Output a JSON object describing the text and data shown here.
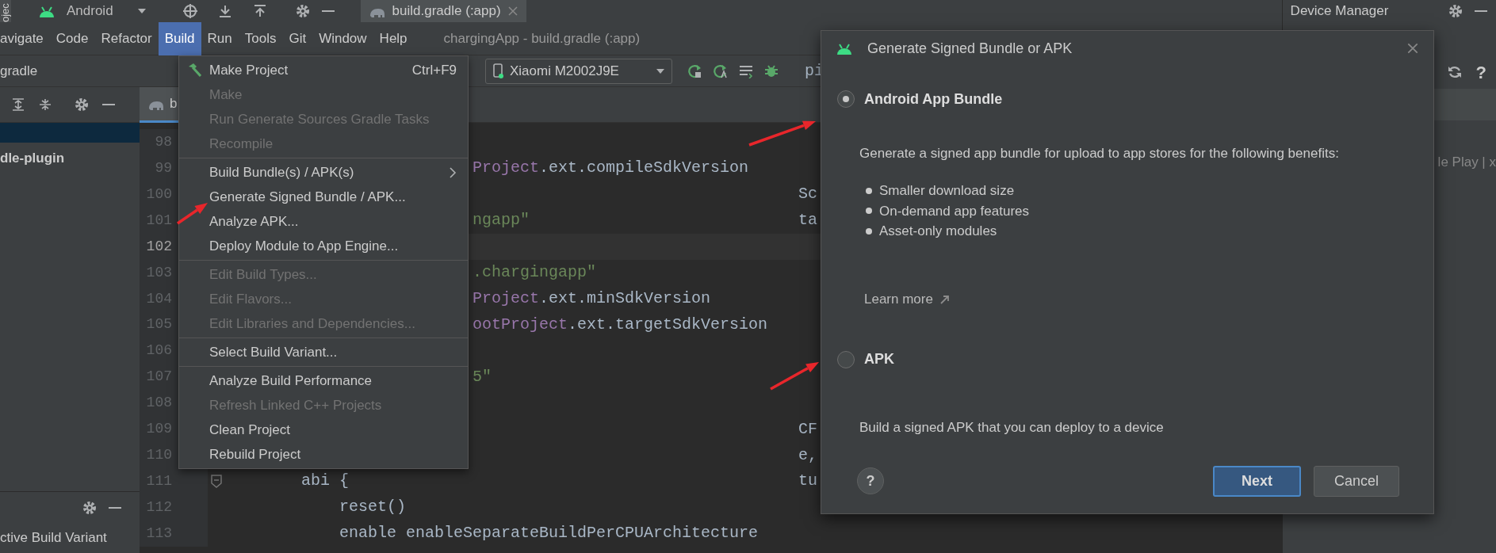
{
  "top_bar": {
    "side_tab": "ojec",
    "project_view": "Android",
    "editor_tab": "build.gradle (:app)"
  },
  "menu_bar": {
    "items": [
      {
        "label": "avigate",
        "selected": false
      },
      {
        "label": "Code",
        "selected": false
      },
      {
        "label": "Refactor",
        "selected": false
      },
      {
        "label": "Build",
        "selected": true
      },
      {
        "label": "Run",
        "selected": false
      },
      {
        "label": "Tools",
        "selected": false
      },
      {
        "label": "Git",
        "selected": false
      },
      {
        "label": "Window",
        "selected": false
      },
      {
        "label": "Help",
        "selected": false
      }
    ],
    "title": "chargingApp - build.gradle (:app)"
  },
  "toolbar": {
    "breadcrumb": "gradle",
    "device": "Xiaomi M2002J9E",
    "editor_fragment": "pi"
  },
  "editor_tabs": [
    {
      "label": "b",
      "selected": true
    }
  ],
  "project_panel": {
    "item": "dle-plugin"
  },
  "build_variants_panel": {
    "title": "ctive Build Variant"
  },
  "code_lines": [
    {
      "number": "98",
      "current": false,
      "kind": "behind_menu"
    },
    {
      "number": "99",
      "current": false,
      "kind": "behind_menu",
      "segments": [
        {
          "text": "Project",
          "kind": "field"
        },
        {
          "text": ".ext.compileSdkVersion",
          "kind": "plain"
        }
      ]
    },
    {
      "number": "100",
      "current": false,
      "kind": "behind_menu",
      "side": "Sc"
    },
    {
      "number": "101",
      "current": false,
      "kind": "behind_menu",
      "segments": [
        {
          "text": "ngapp\"",
          "kind": "string"
        }
      ],
      "side": "ta"
    },
    {
      "number": "102",
      "current": true,
      "kind": "behind_menu"
    },
    {
      "number": "103",
      "current": false,
      "kind": "behind_menu",
      "segments": [
        {
          "text": ".chargingapp\"",
          "kind": "string"
        }
      ]
    },
    {
      "number": "104",
      "current": false,
      "kind": "behind_menu",
      "segments": [
        {
          "text": "Project",
          "kind": "field"
        },
        {
          "text": ".ext.minSdkVersion",
          "kind": "plain"
        }
      ]
    },
    {
      "number": "105",
      "current": false,
      "kind": "behind_menu",
      "segments": [
        {
          "text": "ootProject",
          "kind": "field"
        },
        {
          "text": ".ext.targetSdkVersion",
          "kind": "plain"
        }
      ]
    },
    {
      "number": "106",
      "current": false,
      "kind": "behind_menu"
    },
    {
      "number": "107",
      "current": false,
      "kind": "behind_menu",
      "segments": [
        {
          "text": "5\"",
          "kind": "string"
        }
      ]
    },
    {
      "number": "108",
      "current": false,
      "kind": "behind_menu"
    },
    {
      "number": "109",
      "current": false,
      "kind": "behind_menu",
      "side": "CF"
    },
    {
      "number": "110",
      "current": false,
      "kind": "behind_menu",
      "side": "e,"
    },
    {
      "number": "111",
      "current": false,
      "kind": "full",
      "fold": true,
      "segments": [
        {
          "text": "    abi {",
          "kind": "plain"
        }
      ],
      "side": "tu"
    },
    {
      "number": "112",
      "current": false,
      "kind": "full",
      "segments": [
        {
          "text": "        reset()",
          "kind": "plain"
        }
      ]
    },
    {
      "number": "113",
      "current": false,
      "kind": "full",
      "segments": [
        {
          "text": "        enable enableSeparateBuildPerCPUArchitecture",
          "kind": "plain"
        }
      ]
    }
  ],
  "build_menu": {
    "items": [
      {
        "kind": "icon_item",
        "label": "Make Project",
        "shortcut": "Ctrl+F9",
        "disabled": false
      },
      {
        "kind": "item",
        "label": "Make",
        "disabled": true
      },
      {
        "kind": "item",
        "label": "Run Generate Sources Gradle Tasks",
        "disabled": true
      },
      {
        "kind": "item",
        "label": "Recompile",
        "disabled": true
      },
      {
        "kind": "separator"
      },
      {
        "kind": "item",
        "label": "Build Bundle(s) / APK(s)",
        "submenu": true,
        "disabled": false
      },
      {
        "kind": "item",
        "label": "Generate Signed Bundle / APK...",
        "disabled": false
      },
      {
        "kind": "item",
        "label": "Analyze APK...",
        "disabled": false
      },
      {
        "kind": "item",
        "label": "Deploy Module to App Engine...",
        "disabled": false
      },
      {
        "kind": "separator"
      },
      {
        "kind": "item",
        "label": "Edit Build Types...",
        "disabled": true
      },
      {
        "kind": "item",
        "label": "Edit Flavors...",
        "disabled": true
      },
      {
        "kind": "item",
        "label": "Edit Libraries and Dependencies...",
        "disabled": true
      },
      {
        "kind": "separator"
      },
      {
        "kind": "item",
        "label": "Select Build Variant...",
        "disabled": false
      },
      {
        "kind": "separator"
      },
      {
        "kind": "item",
        "label": "Analyze Build Performance",
        "disabled": false
      },
      {
        "kind": "item",
        "label": "Refresh Linked C++ Projects",
        "disabled": true
      },
      {
        "kind": "item",
        "label": "Clean Project",
        "disabled": false
      },
      {
        "kind": "item",
        "label": "Rebuild Project",
        "disabled": false
      }
    ]
  },
  "dialog": {
    "title": "Generate Signed Bundle or APK",
    "options": [
      {
        "label": "Android App Bundle",
        "selected": true,
        "description": "Generate a signed app bundle for upload to app stores for the following benefits:",
        "bullets": [
          "Smaller download size",
          "On-demand app features",
          "Asset-only modules"
        ],
        "link": "Learn more"
      },
      {
        "label": "APK",
        "selected": false,
        "description": "Build a signed APK that you can deploy to a device"
      }
    ],
    "help": "?",
    "buttons": [
      {
        "label": "Next",
        "kind": "primary"
      },
      {
        "label": "Cancel",
        "kind": "secondary"
      }
    ]
  },
  "device_manager": {
    "title": "Device Manager",
    "help": "?",
    "fragment": "le Play | x"
  }
}
